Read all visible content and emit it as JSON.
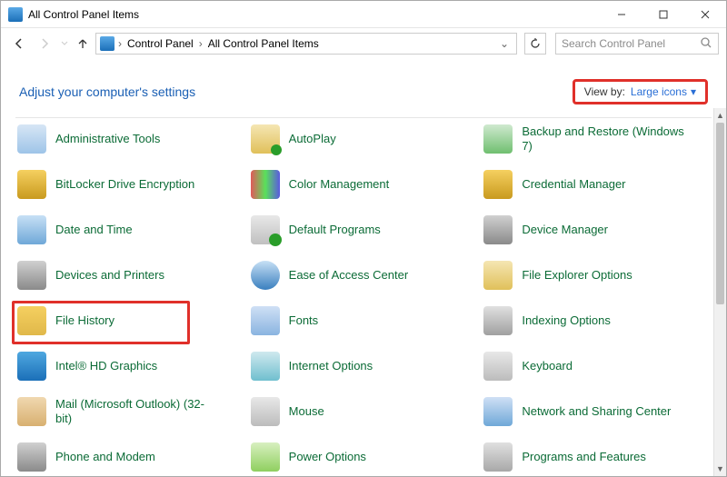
{
  "window": {
    "title": "All Control Panel Items"
  },
  "nav": {
    "crumb1": "Control Panel",
    "crumb2": "All Control Panel Items"
  },
  "search": {
    "placeholder": "Search Control Panel"
  },
  "header": {
    "text": "Adjust your computer's settings",
    "viewby_label": "View by:",
    "viewby_value": "Large icons"
  },
  "items": {
    "admin": "Administrative Tools",
    "autoplay": "AutoPlay",
    "backup": "Backup and Restore (Windows 7)",
    "bitlocker": "BitLocker Drive Encryption",
    "color": "Color Management",
    "cred": "Credential Manager",
    "datetime": "Date and Time",
    "default": "Default Programs",
    "device": "Device Manager",
    "printers": "Devices and Printers",
    "ease": "Ease of Access Center",
    "feo": "File Explorer Options",
    "filehist": "File History",
    "fonts": "Fonts",
    "index": "Indexing Options",
    "intel": "Intel® HD Graphics",
    "inet": "Internet Options",
    "keyboard": "Keyboard",
    "mail": "Mail (Microsoft Outlook) (32-bit)",
    "mouse": "Mouse",
    "network": "Network and Sharing Center",
    "phone": "Phone and Modem",
    "power": "Power Options",
    "progfeat": "Programs and Features"
  }
}
